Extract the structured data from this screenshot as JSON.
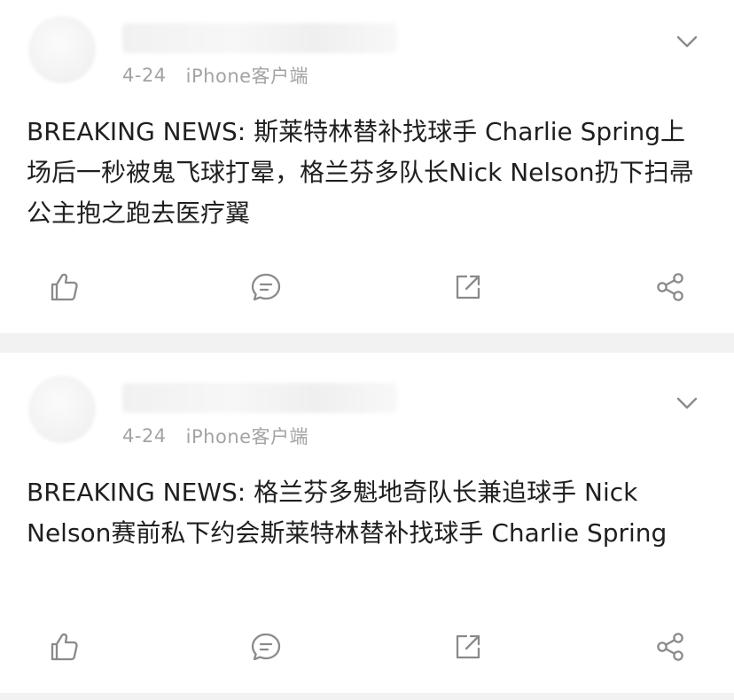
{
  "posts": [
    {
      "time": "4-24",
      "source": "iPhone客户端",
      "content": "BREAKING NEWS: 斯莱特林替补找球手 Charlie Spring上场后一秒被鬼飞球打晕，格兰芬多队长Nick Nelson扔下扫帚公主抱之跑去医疗翼"
    },
    {
      "time": "4-24",
      "source": "iPhone客户端",
      "content": "BREAKING NEWS: 格兰芬多魁地奇队长兼追球手 Nick Nelson赛前私下约会斯莱特林替补找球手 Charlie Spring"
    }
  ],
  "icons": {
    "menu": "chevron-down-icon",
    "like": "thumbs-up-icon",
    "comment": "comment-icon",
    "repost": "repost-icon",
    "share": "share-icon"
  },
  "colors": {
    "icon": "#8a8a8a",
    "meta_text": "#a3a3a3",
    "body_text": "#1f1f1f",
    "separator": "#f2f2f2"
  }
}
